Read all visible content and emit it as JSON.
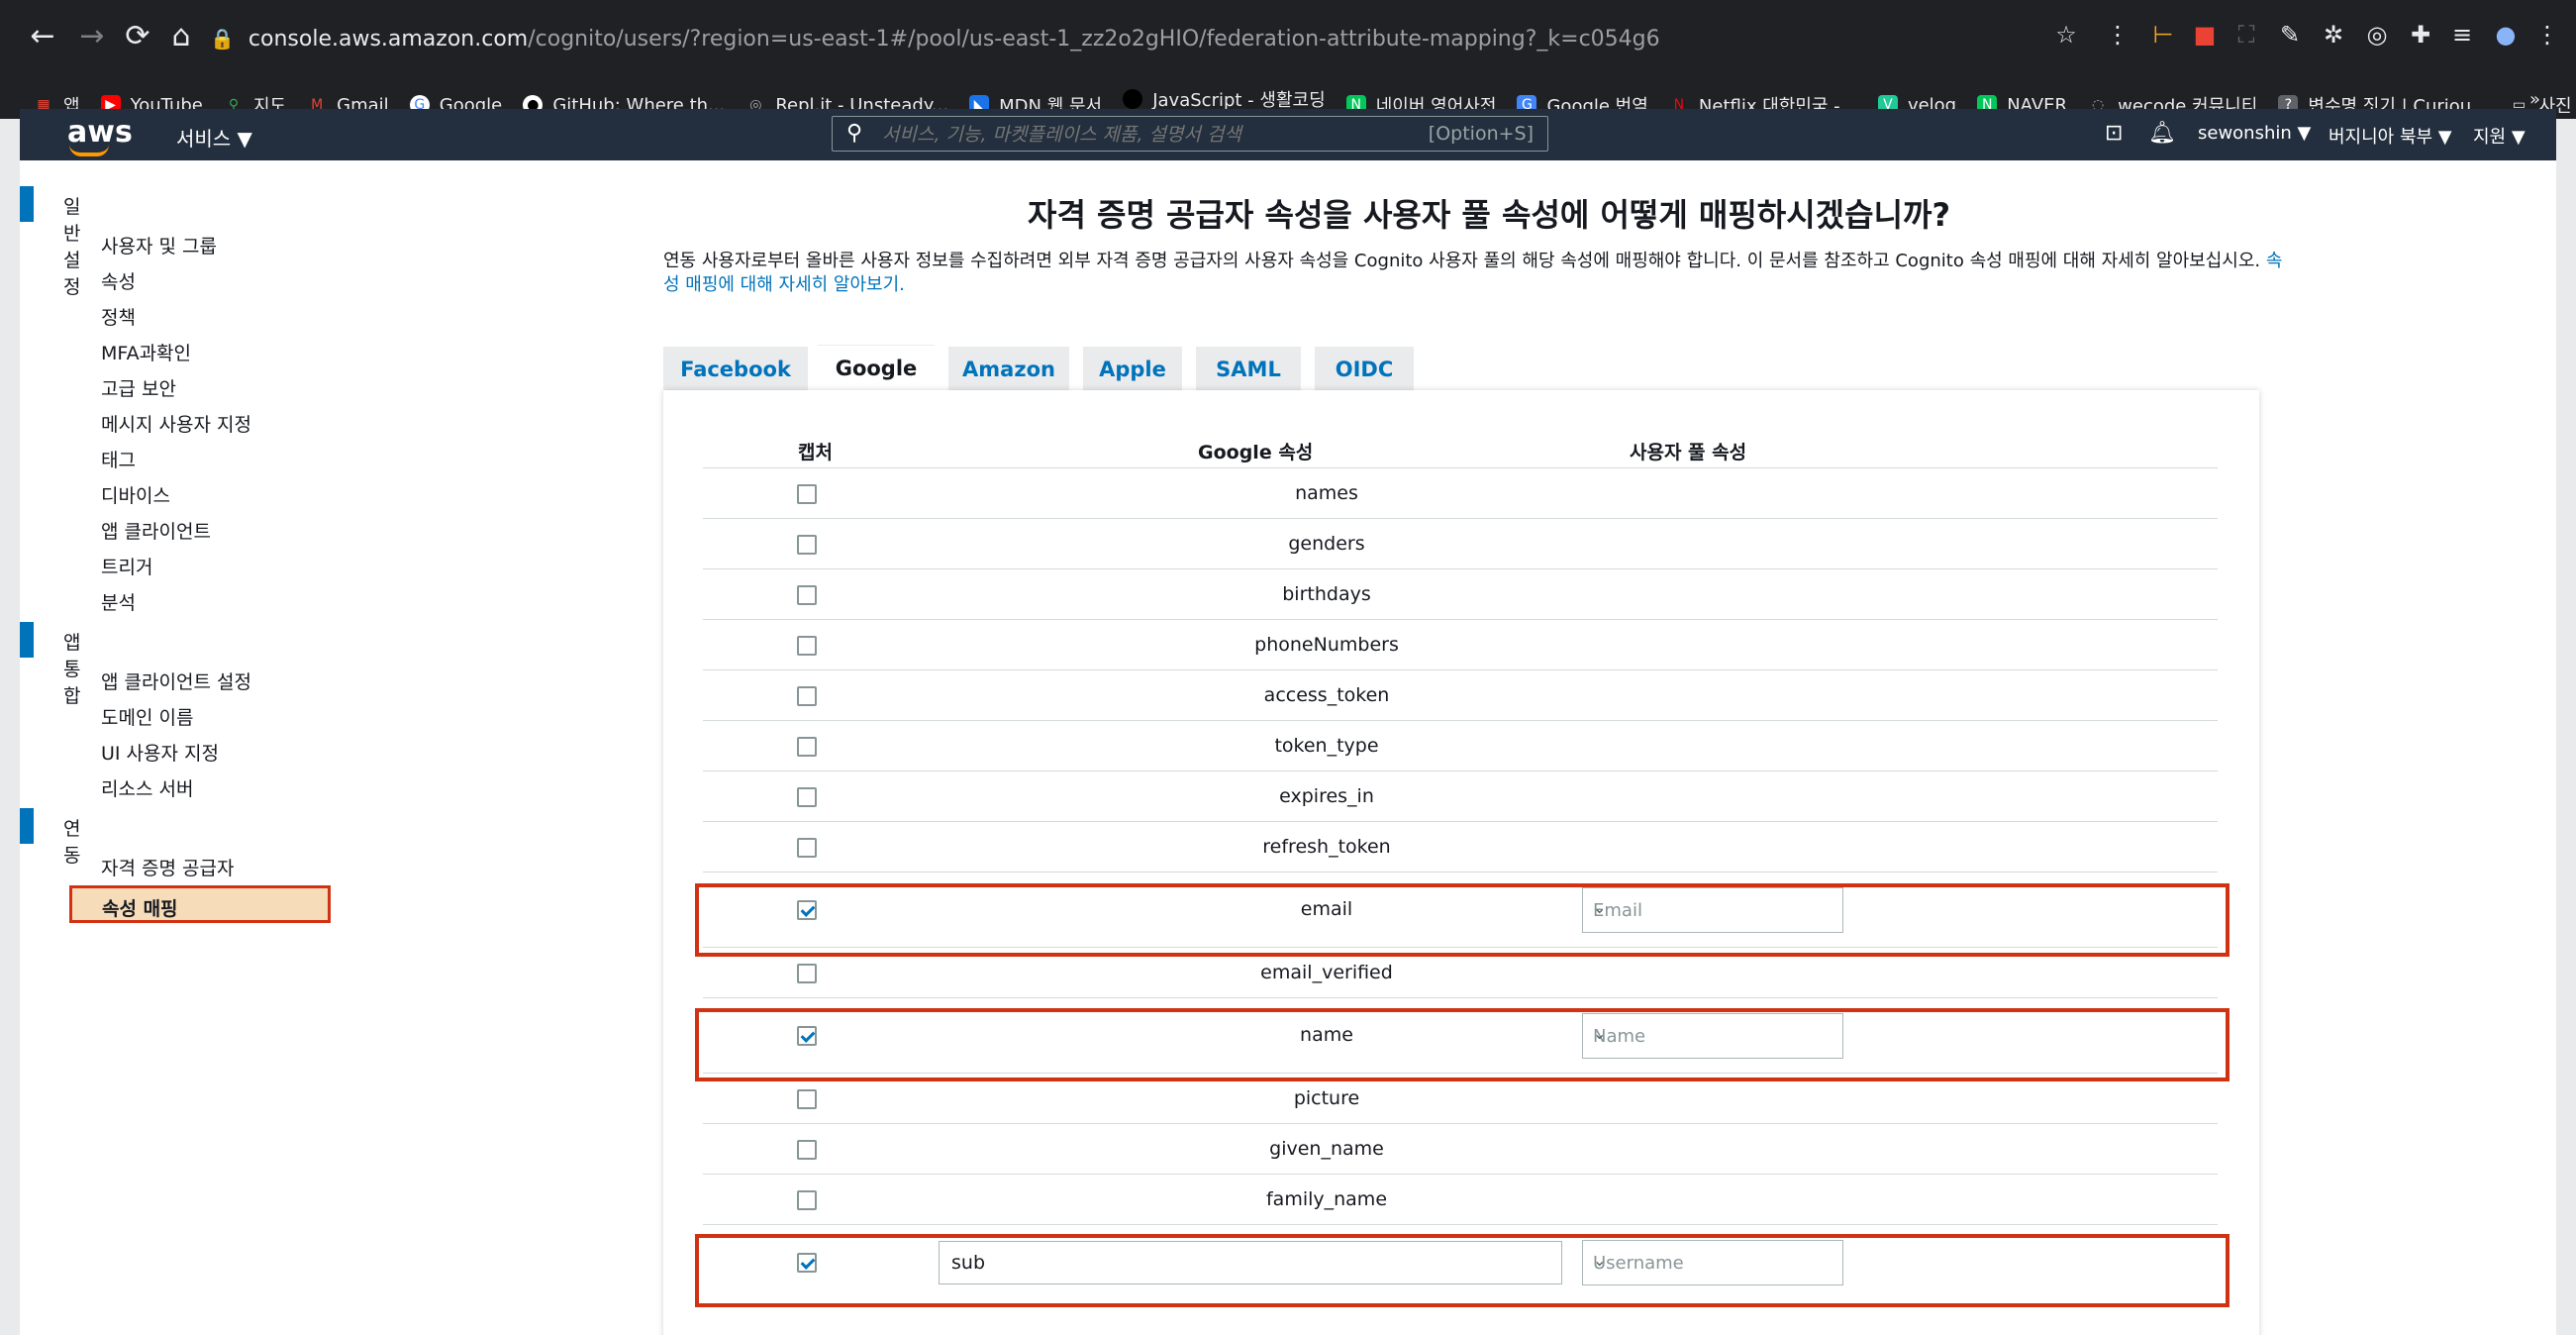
{
  "browser": {
    "url_host": "console.aws.amazon.com",
    "url_path": "/cognito/users/?region=us-east-1#/pool/us-east-1_zz2o2gHIO/federation-attribute-mapping?_k=c054g6",
    "bookmarks": [
      "앱",
      "YouTube",
      "지도",
      "Gmail",
      "Google",
      "GitHub: Where th...",
      "Repl.it - Unsteady...",
      "MDN 웹 문서",
      "JavaScript - 생활코딩",
      "네이버 영어사전",
      "Google 번역",
      "Netflix 대한민국 -...",
      "velog",
      "NAVER",
      "wecode 커뮤니티",
      "변수명 짓기 | Curiou...",
      "사진 편집"
    ],
    "more": "»"
  },
  "aws": {
    "logo": "aws",
    "services": "서비스 ▼",
    "search_placeholder": "서비스, 기능, 마켓플레이스 제품, 설명서 검색",
    "search_hint": "[Option+S]",
    "user": "sewonshin ▼",
    "region": "버지니아 북부 ▼",
    "support": "지원 ▼"
  },
  "sidebar": {
    "sections": [
      {
        "label": "일반 설정",
        "items": [
          "사용자 및 그룹",
          "속성",
          "정책",
          "MFA과확인",
          "고급 보안",
          "메시지 사용자 지정",
          "태그",
          "디바이스",
          "앱 클라이언트",
          "트리거",
          "분석"
        ]
      },
      {
        "label": "앱 통합",
        "items": [
          "앱 클라이언트 설정",
          "도메인 이름",
          "UI 사용자 지정",
          "리소스 서버"
        ]
      },
      {
        "label": "연동",
        "items": [
          "자격 증명 공급자",
          "속성 매핑"
        ]
      }
    ]
  },
  "main": {
    "title": "자격 증명 공급자 속성을 사용자 풀 속성에 어떻게 매핑하시겠습니까?",
    "description": "연동 사용자로부터 올바른 사용자 정보를 수집하려면 외부 자격 증명 공급자의 사용자 속성을 Cognito 사용자 풀의 해당 속성에 매핑해야 합니다. 이 문서를 참조하고 Cognito 속성 매핑에 대해 자세히 알아보십시오. ",
    "description_link": "속성 매핑에 대해 자세히 알아보기.",
    "tabs": [
      "Facebook",
      "Google",
      "Amazon",
      "Apple",
      "SAML",
      "OIDC"
    ],
    "active_tab": "Google",
    "columns": {
      "capture": "캡처",
      "provider_attr": "Google 속성",
      "pool_attr": "사용자 풀 속성"
    },
    "rows": [
      {
        "attr": "names",
        "checked": false
      },
      {
        "attr": "genders",
        "checked": false
      },
      {
        "attr": "birthdays",
        "checked": false
      },
      {
        "attr": "phoneNumbers",
        "checked": false
      },
      {
        "attr": "access_token",
        "checked": false
      },
      {
        "attr": "token_type",
        "checked": false
      },
      {
        "attr": "expires_in",
        "checked": false
      },
      {
        "attr": "refresh_token",
        "checked": false
      },
      {
        "attr": "email",
        "checked": true,
        "mapped": "Email"
      },
      {
        "attr": "email_verified",
        "checked": false
      },
      {
        "attr": "name",
        "checked": true,
        "mapped": "Name"
      },
      {
        "attr": "picture",
        "checked": false
      },
      {
        "attr": "given_name",
        "checked": false
      },
      {
        "attr": "family_name",
        "checked": false
      },
      {
        "attr": "sub",
        "checked": true,
        "mapped": "Username",
        "custom_input": true
      }
    ]
  },
  "colors": {
    "aws_header": "#232f3e",
    "accent": "#0073bb",
    "highlight": "#d13212"
  }
}
